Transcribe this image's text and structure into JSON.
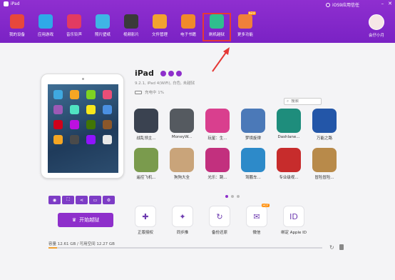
{
  "window": {
    "title": "iPad",
    "trust_text": "iOS9应用信任"
  },
  "nav": [
    {
      "label": "我的设备",
      "icon": "store-icon",
      "color": "#e8483c"
    },
    {
      "label": "应用游戏",
      "icon": "appstore-icon",
      "color": "#2fa9e8"
    },
    {
      "label": "音乐铃声",
      "icon": "music-disc-icon",
      "color": "#e23b62"
    },
    {
      "label": "照片壁纸",
      "icon": "photo-icon",
      "color": "#3fb5e5"
    },
    {
      "label": "视频影片",
      "icon": "clapperboard-icon",
      "color": "#3a3a3a"
    },
    {
      "label": "文件管理",
      "icon": "folder-icon",
      "color": "#f2a22f"
    },
    {
      "label": "电子书籍",
      "icon": "book-icon",
      "color": "#f08a2a"
    },
    {
      "label": "刷机越狱",
      "icon": "jailbreak-icon",
      "color": "#2fbf8e",
      "selected": true
    },
    {
      "label": "更多功能",
      "icon": "grid-icon",
      "color": "#f0803a",
      "badge": "NEW"
    }
  ],
  "user": {
    "name": "会仔小月"
  },
  "device": {
    "name": "iPad",
    "subtitle": "9.2.1, iPad 4(WiFi), 白色, 未越狱",
    "battery": "充电中  1%"
  },
  "search": {
    "placeholder": "搜索"
  },
  "apps": [
    {
      "label": "战乱领主...",
      "color": "#3a4250"
    },
    {
      "label": "MoneyW...",
      "color": "#555a60"
    },
    {
      "label": "玩星：生...",
      "color": "#d93f8e"
    },
    {
      "label": "梦境旋律",
      "color": "#4b79b8"
    },
    {
      "label": "Dashlane...",
      "color": "#1e8d7c"
    },
    {
      "label": "万能之路",
      "color": "#2356a8"
    },
    {
      "label": "遥控飞机...",
      "color": "#7a9b4d"
    },
    {
      "label": "狗狗大全",
      "color": "#c9a47a"
    },
    {
      "label": "光乐：跳...",
      "color": "#c2307e"
    },
    {
      "label": "驾鹏车...",
      "color": "#2d8ac9"
    },
    {
      "label": "专业级视...",
      "color": "#c72c2c"
    },
    {
      "label": "冒险冒险...",
      "color": "#b88a4a"
    }
  ],
  "jailbreak_button": "开始越狱",
  "functions": [
    {
      "label": "正版授权",
      "icon": "wrench-icon",
      "glyph": "✚"
    },
    {
      "label": "同步推",
      "icon": "feather-icon",
      "glyph": "✦"
    },
    {
      "label": "备份还原",
      "icon": "backup-icon",
      "glyph": "↻"
    },
    {
      "label": "微信",
      "icon": "wechat-icon",
      "glyph": "✉",
      "badge": "HOT"
    },
    {
      "label": "绑定 Apple ID",
      "icon": "apple-id-icon",
      "glyph": "ID"
    }
  ],
  "storage": {
    "text": "容量  12.61 GB / 可用空间  12.27 GB",
    "used_fraction": 0.03
  }
}
